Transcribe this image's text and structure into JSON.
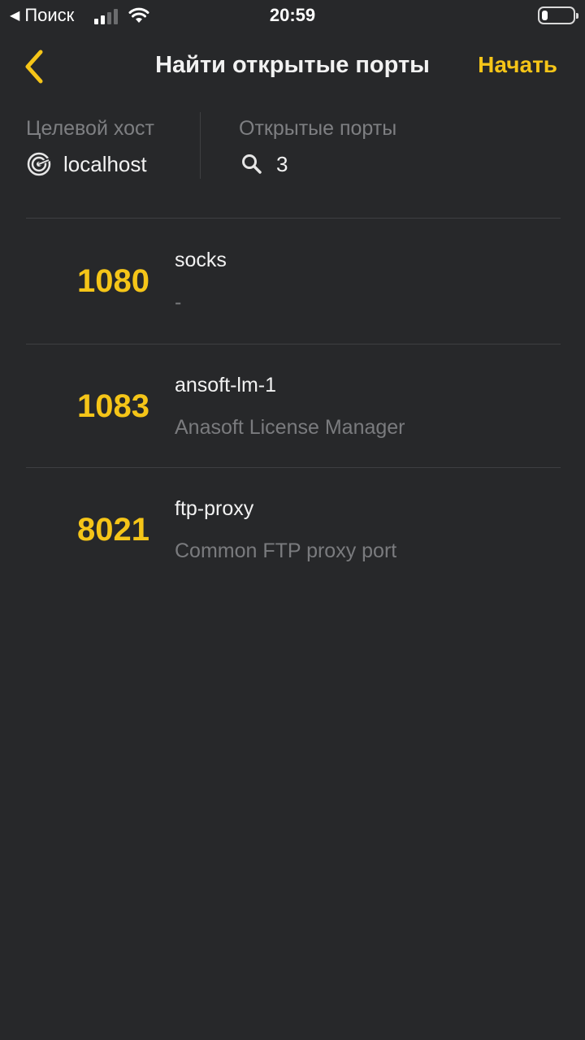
{
  "status_bar": {
    "back_label": "Поиск",
    "time": "20:59",
    "battery_level": 0.2
  },
  "nav": {
    "title": "Найти открытые порты",
    "start_label": "Начать"
  },
  "summary": {
    "target_label": "Целевой хост",
    "target_value": "localhost",
    "ports_label": "Открытые порты",
    "ports_count": "3"
  },
  "colors": {
    "background": "#27282a",
    "accent": "#f5c518",
    "divider": "#3e3f42",
    "secondary_text": "#7a7b7e"
  },
  "ports": [
    {
      "port": "1080",
      "service": "socks",
      "description": "-"
    },
    {
      "port": "1083",
      "service": "ansoft-lm-1",
      "description": "Anasoft License Manager"
    },
    {
      "port": "8021",
      "service": "ftp-proxy",
      "description": "Common FTP proxy port"
    }
  ]
}
